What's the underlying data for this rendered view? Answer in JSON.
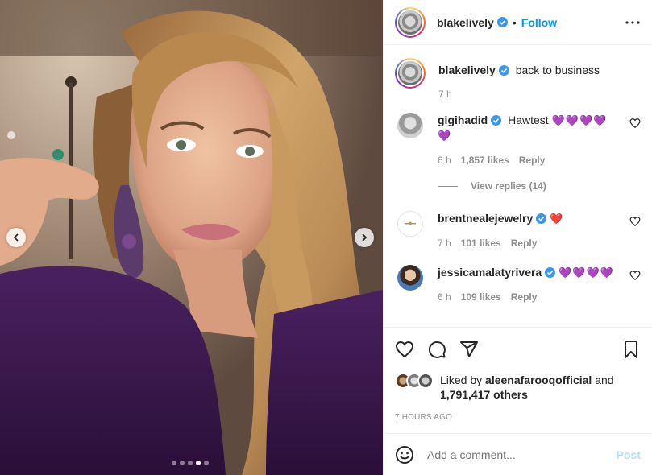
{
  "post": {
    "username": "blakelively",
    "follow_label": "Follow",
    "separator": "•",
    "caption": "back to business",
    "caption_time": "7 h"
  },
  "carousel": {
    "slide_count": 5,
    "active_index": 3
  },
  "comments": [
    {
      "username": "gigihadid",
      "text": "Hawtest",
      "emojis": "💜💜💜💜",
      "emojis_line2": "💜",
      "time": "6 h",
      "likes": "1,857 likes",
      "reply_label": "Reply",
      "view_replies": "View replies (14)"
    },
    {
      "username": "brentnealejewelry",
      "text": "",
      "emojis": "❤️",
      "time": "7 h",
      "likes": "101 likes",
      "reply_label": "Reply"
    },
    {
      "username": "jessicamalatyrivera",
      "text": "",
      "emojis": "💜💜💜💜",
      "time": "6 h",
      "likes": "109 likes",
      "reply_label": "Reply"
    }
  ],
  "likes": {
    "prefix": "Liked by",
    "user": "aleenafarooqofficial",
    "and": "and",
    "count": "1,791,417 others"
  },
  "timestamp": "7 HOURS AGO",
  "add_comment": {
    "placeholder": "Add a comment...",
    "post_label": "Post"
  },
  "colors": {
    "accent": "#0095f6",
    "post_disabled": "#b2dffc",
    "muted": "#8e8e8e",
    "dress": "#3b1a4a"
  }
}
